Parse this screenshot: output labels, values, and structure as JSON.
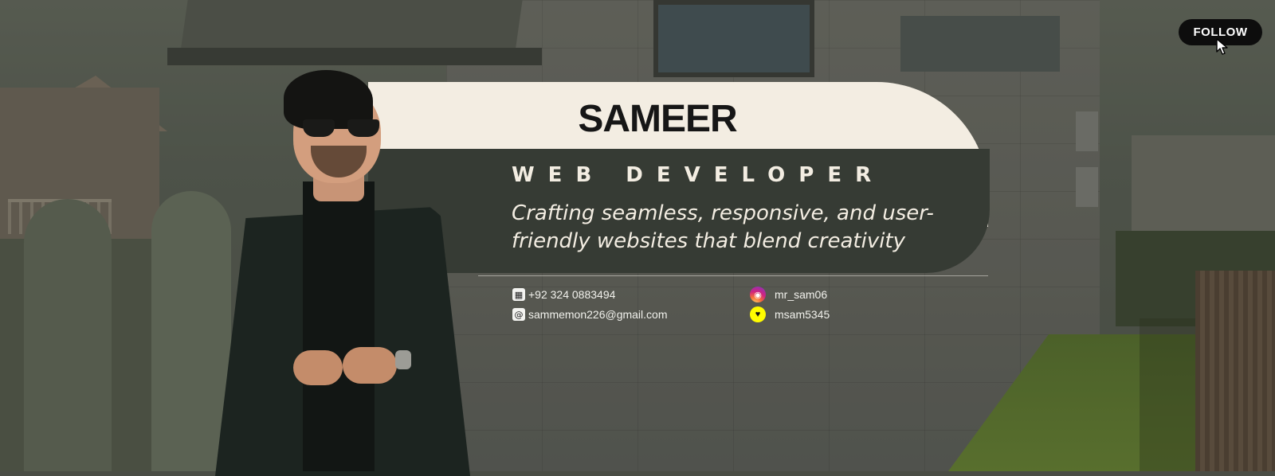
{
  "profile": {
    "name": "SAMEER",
    "role": "WEB DEVELOPER",
    "tagline": "Crafting seamless, responsive, and user-friendly websites that blend creativity"
  },
  "contacts": {
    "phone": "+92 324 0883494",
    "email": "sammemon226@gmail.com",
    "instagram": "mr_sam06",
    "snapchat": "msam5345"
  },
  "actions": {
    "follow_label": "FOLLOW"
  },
  "colors": {
    "cream": "#f3ede2",
    "dark_olive": "#363b34",
    "button_black": "#0d0d0d"
  },
  "icons": {
    "phone": "contact-card-icon",
    "email": "at-sign-icon",
    "instagram": "instagram-icon",
    "snapchat": "snapchat-icon",
    "cursor": "mouse-cursor-icon"
  }
}
